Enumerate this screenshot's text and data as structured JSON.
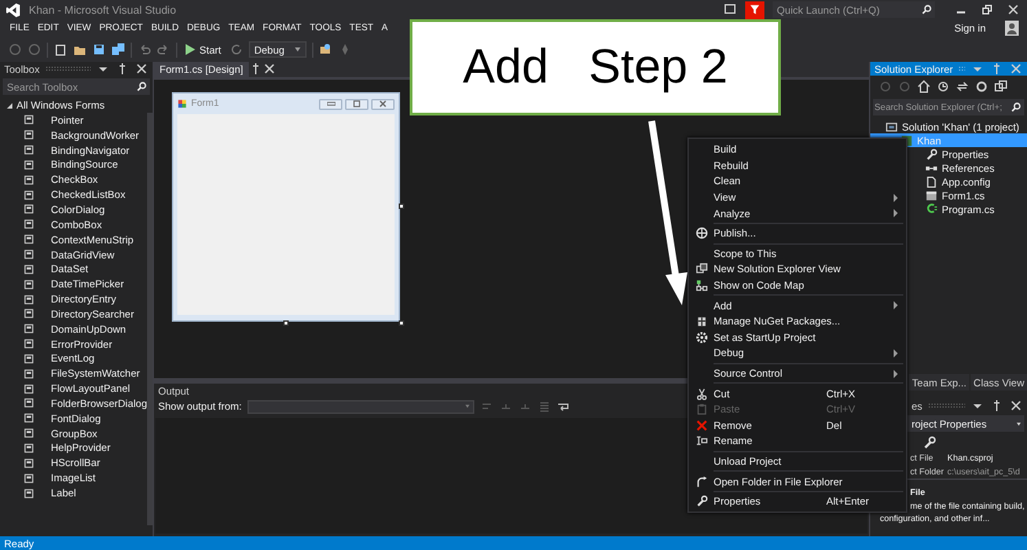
{
  "window": {
    "title": "Khan - Microsoft Visual Studio"
  },
  "quick_launch": {
    "placeholder": "Quick Launch (Ctrl+Q)"
  },
  "menu_bar": [
    "FILE",
    "EDIT",
    "VIEW",
    "PROJECT",
    "BUILD",
    "DEBUG",
    "TEAM",
    "FORMAT",
    "TOOLS",
    "TEST",
    "A"
  ],
  "account": {
    "label": "Sign in"
  },
  "toolbar": {
    "start": "Start",
    "configuration": "Debug"
  },
  "toolbox": {
    "title": "Toolbox",
    "search": {
      "placeholder": "Search Toolbox"
    },
    "group": {
      "label": "All Windows Forms",
      "expanded": true,
      "items": [
        "Pointer",
        "BackgroundWorker",
        "BindingNavigator",
        "BindingSource",
        "CheckBox",
        "CheckedListBox",
        "ColorDialog",
        "ComboBox",
        "ContextMenuStrip",
        "DataGridView",
        "DataSet",
        "DateTimePicker",
        "DirectoryEntry",
        "DirectorySearcher",
        "DomainUpDown",
        "ErrorProvider",
        "EventLog",
        "FileSystemWatcher",
        "FlowLayoutPanel",
        "FolderBrowserDialog",
        "FontDialog",
        "GroupBox",
        "HelpProvider",
        "HScrollBar",
        "ImageList",
        "Label"
      ]
    }
  },
  "document_tabs": [
    {
      "label": "Form1.cs [Design]",
      "selected": true
    }
  ],
  "designer": {
    "form_title": "Form1"
  },
  "output": {
    "title": "Output",
    "source_label": "Show output from:"
  },
  "solution_explorer": {
    "title": "Solution Explorer",
    "search": {
      "placeholder": "Search Solution Explorer (Ctrl+;"
    },
    "tree": [
      {
        "label": "Solution 'Khan' (1 project)",
        "kind": "solution",
        "selected": false,
        "children": [
          {
            "label": "Khan",
            "kind": "project",
            "selected": true,
            "children": [
              {
                "label": "Properties",
                "kind": "properties",
                "selected": false
              },
              {
                "label": "References",
                "kind": "references",
                "selected": false
              },
              {
                "label": "App.config",
                "kind": "config",
                "selected": false
              },
              {
                "label": "Form1.cs",
                "kind": "form",
                "selected": false
              },
              {
                "label": "Program.cs",
                "kind": "code",
                "selected": false
              }
            ]
          }
        ]
      }
    ]
  },
  "panel_tabs": [
    {
      "label": "Team Exp...",
      "selected": false
    },
    {
      "label": "Class View",
      "selected": false
    }
  ],
  "properties": {
    "title": "es",
    "object": "roject Properties",
    "rows": [
      {
        "name": "ct File",
        "value": "Khan.csproj"
      },
      {
        "name": "ct Folder",
        "value": "c:\\users\\ait_pc_5\\d"
      }
    ],
    "description_title": "File",
    "description": "me of the file containing build, configuration, and other inf..."
  },
  "context_menu": {
    "groups": [
      [
        {
          "label": "Build",
          "submenu": false,
          "disabled": false
        },
        {
          "label": "Rebuild",
          "submenu": false,
          "disabled": false
        },
        {
          "label": "Clean",
          "submenu": false,
          "disabled": false
        },
        {
          "label": "View",
          "submenu": true,
          "disabled": false
        },
        {
          "label": "Analyze",
          "submenu": true,
          "disabled": false
        }
      ],
      [
        {
          "label": "Publish...",
          "submenu": false,
          "disabled": false
        }
      ],
      [
        {
          "label": "Scope to This",
          "submenu": false,
          "disabled": false
        },
        {
          "label": "New Solution Explorer View",
          "submenu": false,
          "disabled": false
        },
        {
          "label": "Show on Code Map",
          "submenu": false,
          "disabled": false
        }
      ],
      [
        {
          "label": "Add",
          "submenu": true,
          "disabled": false
        },
        {
          "label": "Manage NuGet Packages...",
          "submenu": false,
          "disabled": false
        },
        {
          "label": "Set as StartUp Project",
          "submenu": false,
          "disabled": false
        },
        {
          "label": "Debug",
          "submenu": true,
          "disabled": false
        }
      ],
      [
        {
          "label": "Source Control",
          "submenu": true,
          "disabled": false
        }
      ],
      [
        {
          "label": "Cut",
          "shortcut": "Ctrl+X",
          "submenu": false,
          "disabled": false
        },
        {
          "label": "Paste",
          "shortcut": "Ctrl+V",
          "submenu": false,
          "disabled": true
        },
        {
          "label": "Remove",
          "shortcut": "Del",
          "submenu": false,
          "disabled": false
        },
        {
          "label": "Rename",
          "submenu": false,
          "disabled": false
        }
      ],
      [
        {
          "label": "Unload Project",
          "submenu": false,
          "disabled": false
        }
      ],
      [
        {
          "label": "Open Folder in File Explorer",
          "submenu": false,
          "disabled": false
        }
      ],
      [
        {
          "label": "Properties",
          "shortcut": "Alt+Enter",
          "submenu": false,
          "disabled": false
        }
      ]
    ]
  },
  "callout": {
    "text": "Add   Step 2"
  },
  "status_bar": {
    "text": "Ready"
  }
}
